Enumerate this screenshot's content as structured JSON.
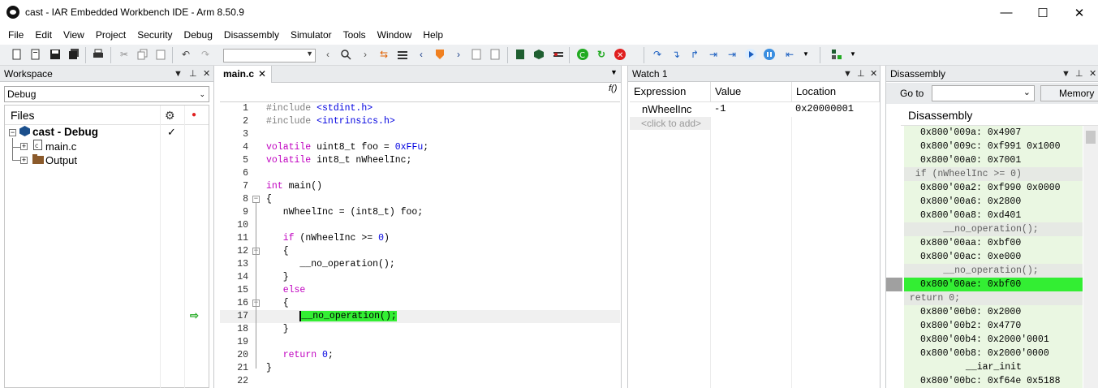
{
  "window": {
    "title": "cast - IAR Embedded Workbench IDE - Arm 8.50.9",
    "minimize": "—",
    "maximize": "☐",
    "close": "✕"
  },
  "menu": [
    "File",
    "Edit",
    "View",
    "Project",
    "Security",
    "Debug",
    "Disassembly",
    "Simulator",
    "Tools",
    "Window",
    "Help"
  ],
  "workspace": {
    "title": "Workspace",
    "configuration": "Debug",
    "files_header": "Files",
    "project": "cast - Debug",
    "items": [
      "main.c",
      "Output"
    ]
  },
  "editor": {
    "tab": "main.c",
    "func_button": "f()",
    "current_line": 17,
    "lines": [
      {
        "n": "1",
        "html": "<span class=\"pp\">#include </span><span class=\"str\">&lt;stdint.h&gt;</span>"
      },
      {
        "n": "2",
        "html": "<span class=\"pp\">#include </span><span class=\"str\">&lt;intrinsics.h&gt;</span>"
      },
      {
        "n": "3",
        "html": ""
      },
      {
        "n": "4",
        "html": "<span class=\"kw\">volatile</span> uint8_t foo = <span class=\"num\">0xFFu</span>;"
      },
      {
        "n": "5",
        "html": "<span class=\"kw\">volatile</span> int8_t nWheelInc;"
      },
      {
        "n": "6",
        "html": ""
      },
      {
        "n": "7",
        "html": "<span class=\"kw\">int</span> main()"
      },
      {
        "n": "8",
        "html": "{"
      },
      {
        "n": "9",
        "html": "   nWheelInc = (int8_t) foo;"
      },
      {
        "n": "10",
        "html": ""
      },
      {
        "n": "11",
        "html": "   <span class=\"kw\">if</span> (nWheelInc &gt;= <span class=\"num\">0</span>)"
      },
      {
        "n": "12",
        "html": "   {"
      },
      {
        "n": "13",
        "html": "      __no_operation();"
      },
      {
        "n": "14",
        "html": "   }"
      },
      {
        "n": "15",
        "html": "   <span class=\"kw\">else</span>"
      },
      {
        "n": "16",
        "html": "   {"
      },
      {
        "n": "17",
        "html": "      __no_operation();"
      },
      {
        "n": "18",
        "html": "   }"
      },
      {
        "n": "19",
        "html": ""
      },
      {
        "n": "20",
        "html": "   <span class=\"kw\">return</span> <span class=\"num\">0</span>;"
      },
      {
        "n": "21",
        "html": "}"
      },
      {
        "n": "22",
        "html": ""
      }
    ]
  },
  "watch": {
    "title": "Watch 1",
    "columns": [
      "Expression",
      "Value",
      "Location"
    ],
    "rows": [
      {
        "expression": "nWheelInc",
        "value": "-1",
        "location": "0x20000001"
      }
    ],
    "add_placeholder": "<click to add>"
  },
  "disassembly": {
    "title": "Disassembly",
    "goto_label": "Go to",
    "memory_button": "Memory",
    "header": "Disassembly",
    "lines": [
      {
        "text": "0x800'009a: 0x4907",
        "kind": "code"
      },
      {
        "text": "0x800'009c: 0xf991 0x1000",
        "kind": "code"
      },
      {
        "text": "0x800'00a0: 0x7001",
        "kind": "code"
      },
      {
        "text": "  if (nWheelInc >= 0)",
        "kind": "src"
      },
      {
        "text": "0x800'00a2: 0xf990 0x0000",
        "kind": "code"
      },
      {
        "text": "0x800'00a6: 0x2800",
        "kind": "code"
      },
      {
        "text": "0x800'00a8: 0xd401",
        "kind": "code"
      },
      {
        "text": "       __no_operation();",
        "kind": "src"
      },
      {
        "text": "0x800'00aa: 0xbf00",
        "kind": "code"
      },
      {
        "text": "0x800'00ac: 0xe000",
        "kind": "code"
      },
      {
        "text": "       __no_operation();",
        "kind": "src"
      },
      {
        "text": "0x800'00ae: 0xbf00",
        "kind": "current"
      },
      {
        "text": " return 0;",
        "kind": "src"
      },
      {
        "text": "0x800'00b0: 0x2000",
        "kind": "code"
      },
      {
        "text": "0x800'00b2: 0x4770",
        "kind": "code"
      },
      {
        "text": "0x800'00b4: 0x2000'0001",
        "kind": "code"
      },
      {
        "text": "0x800'00b8: 0x2000'0000",
        "kind": "code"
      },
      {
        "text": "           __iar_init",
        "kind": "label"
      },
      {
        "text": "0x800'00bc: 0xf64e 0x5188",
        "kind": "code"
      }
    ]
  },
  "colors": {
    "highlight_green": "#33ee33",
    "disasm_bg": "#eaf7e2",
    "pc_arrow": "#22aa22"
  },
  "icons": [
    "new-file-icon",
    "open-icon",
    "save-icon",
    "save-all-icon",
    "print-icon",
    "cut-icon",
    "copy-icon",
    "paste-icon",
    "undo-icon",
    "redo-icon",
    "back-icon",
    "find-icon",
    "forward-icon",
    "go-icon",
    "debug-icon",
    "stop-icon",
    "step-icon"
  ]
}
